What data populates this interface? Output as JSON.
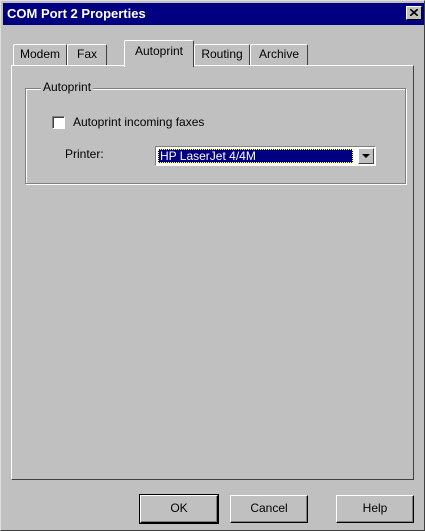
{
  "window": {
    "title": "COM Port 2 Properties"
  },
  "tabs": [
    {
      "label": "Modem",
      "active": false
    },
    {
      "label": "Fax",
      "active": false
    },
    {
      "label": "Autoprint",
      "active": true
    },
    {
      "label": "Routing",
      "active": false
    },
    {
      "label": "Archive",
      "active": false
    }
  ],
  "autoprint": {
    "group_label": "Autoprint",
    "checkbox_label": "Autoprint incoming faxes",
    "checkbox_checked": false,
    "printer_label": "Printer:",
    "printer_value": "HP LaserJet 4/4M"
  },
  "buttons": {
    "ok": "OK",
    "cancel": "Cancel",
    "help": "Help"
  },
  "icons": {
    "close": "close-icon",
    "dropdown": "chevron-down-icon"
  }
}
